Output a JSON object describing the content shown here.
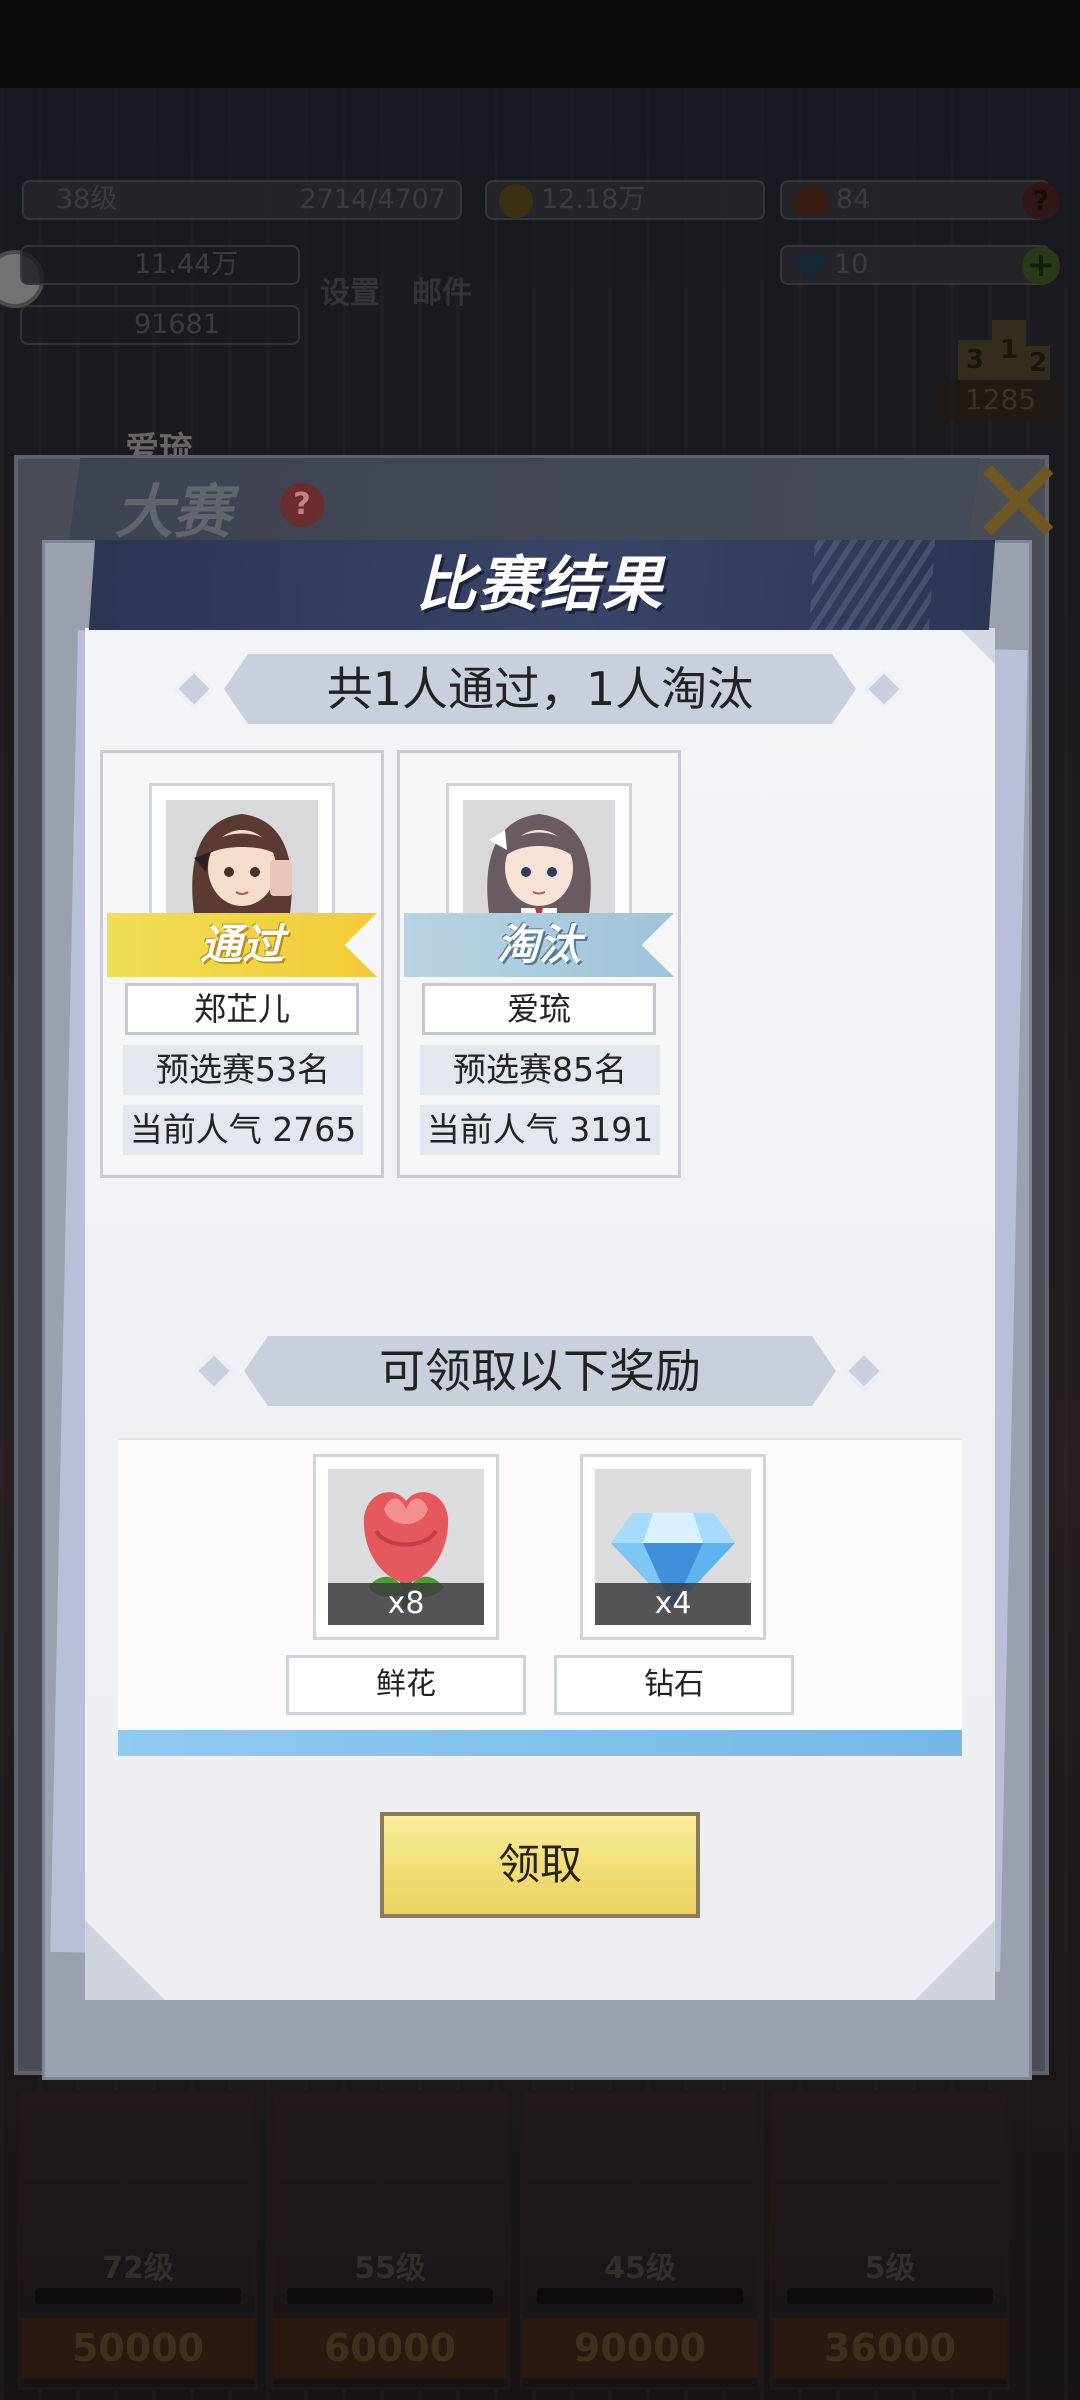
{
  "background": {
    "hud": {
      "level": "38级",
      "exp": "2714/4707",
      "coins": "12.18万",
      "hearts": "84",
      "diamonds": "10",
      "power": "11.44万",
      "flowers": "91681",
      "menu_settings": "设置",
      "menu_mail": "邮件",
      "rank_score": "1285",
      "rank_numbers": [
        "3",
        "1",
        "2"
      ]
    },
    "contest_title": "大赛",
    "contest_name": "爱琉",
    "characters": [
      {
        "level": "72级",
        "price": "50000"
      },
      {
        "level": "55级",
        "price": "60000"
      },
      {
        "level": "45级",
        "price": "90000"
      },
      {
        "level": "5级",
        "price": "36000"
      }
    ]
  },
  "dialog": {
    "title": "比赛结果",
    "summary": "共1人通过，1人淘汰",
    "players": [
      {
        "status": "通过",
        "name": "郑芷儿",
        "rank": "预选赛53名",
        "popularity": "当前人气 2765"
      },
      {
        "status": "淘汰",
        "name": "爱琉",
        "rank": "预选赛85名",
        "popularity": "当前人气 3191"
      }
    ],
    "reward_header": "可领取以下奖励",
    "rewards": [
      {
        "name": "鲜花",
        "qty": "x8",
        "icon": "rose-icon"
      },
      {
        "name": "钻石",
        "qty": "x4",
        "icon": "diamond-icon"
      }
    ],
    "claim_label": "领取"
  },
  "colors": {
    "pass": "#f1cb36",
    "fail": "#9fc3d9",
    "title_bar": "#2c3552",
    "claim_button": "#f2df7a",
    "reward_bar": "#74b8e8"
  }
}
